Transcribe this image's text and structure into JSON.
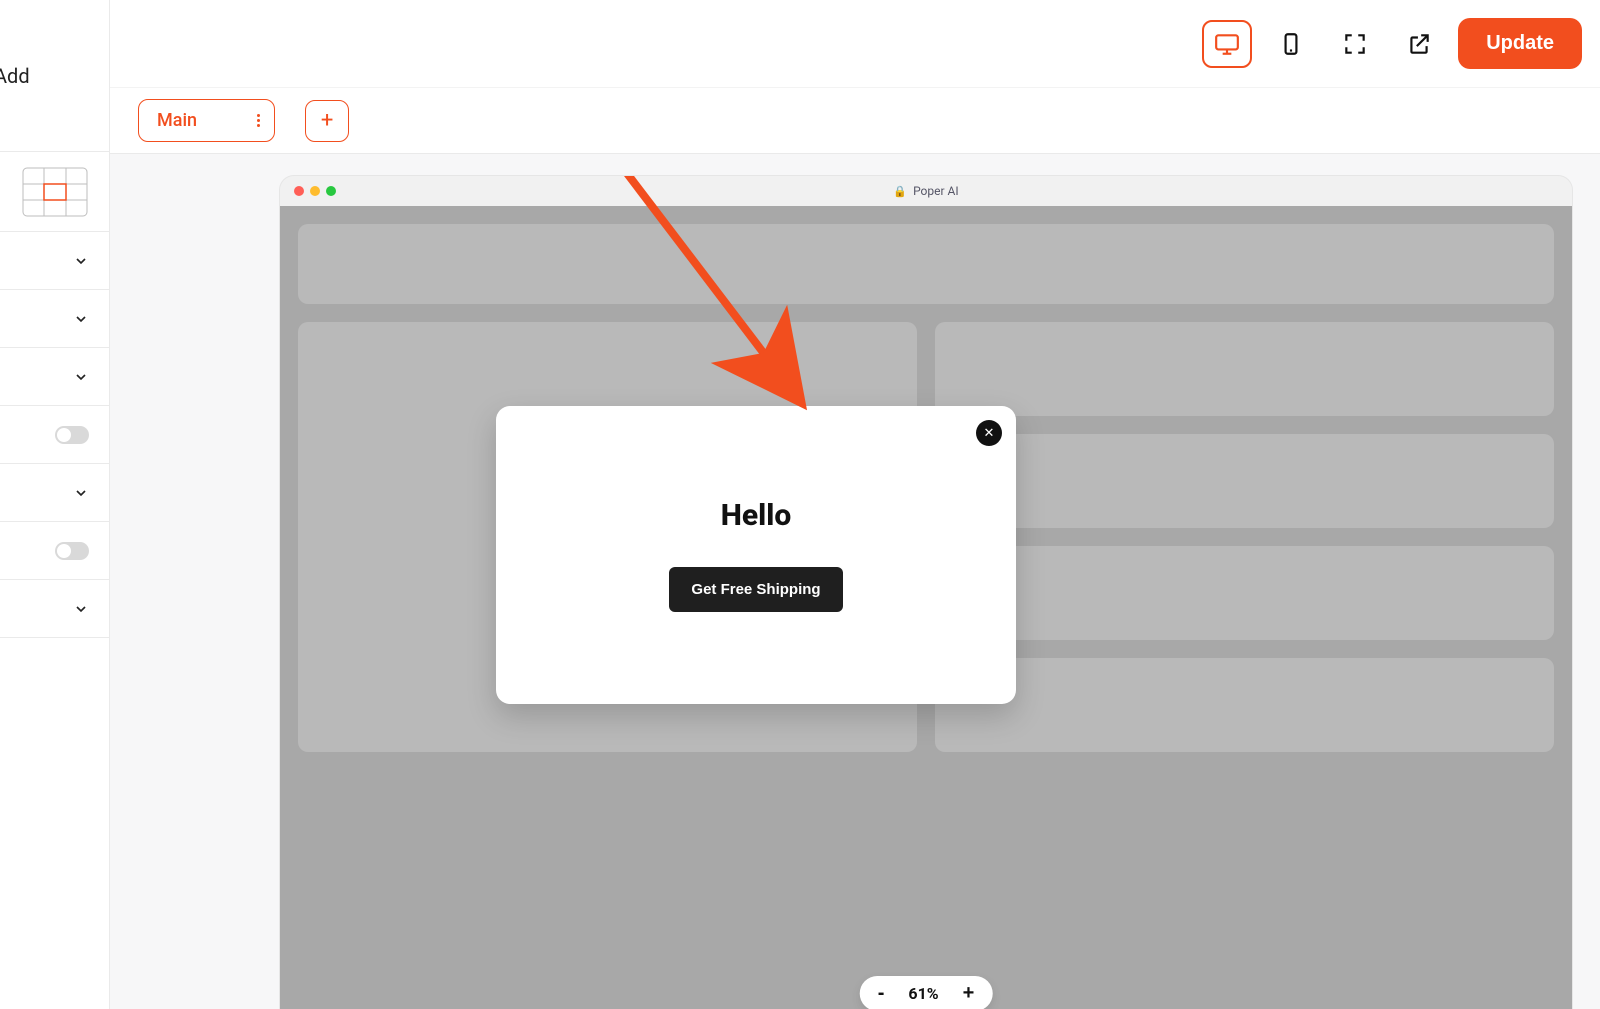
{
  "header": {
    "update_label": "Update"
  },
  "sidebar": {
    "add_label": "Add"
  },
  "subbar": {
    "chip_label": "Main",
    "add_btn": "+"
  },
  "mock": {
    "title": "Poper AI"
  },
  "popup": {
    "title": "Hello",
    "button_label": "Get Free Shipping",
    "close_glyph": "✕"
  },
  "zoom": {
    "minus": "-",
    "plus": "+",
    "value": "61%"
  }
}
